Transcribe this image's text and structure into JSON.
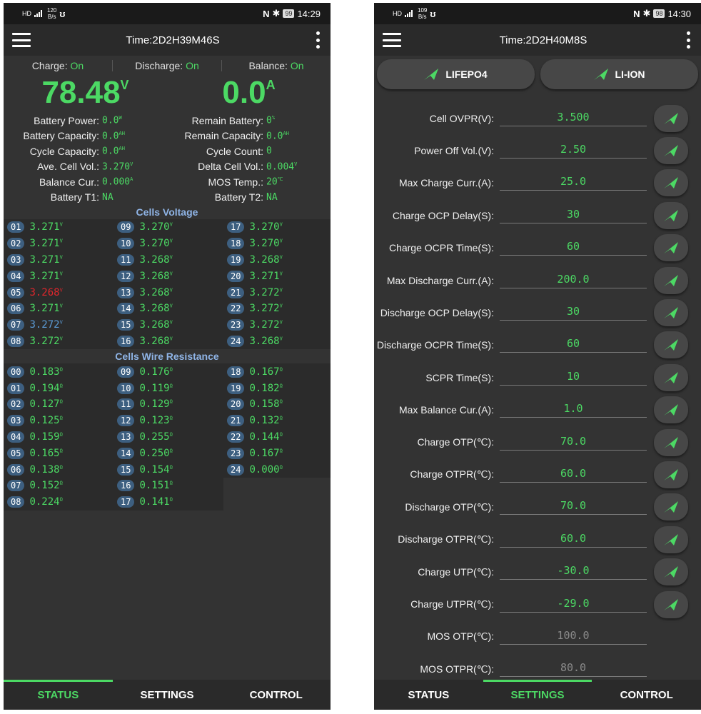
{
  "left": {
    "status_bar": {
      "net": "HD",
      "speed": "120",
      "speed_unit": "B/s",
      "battery": "99",
      "time": "14:29"
    },
    "app_bar": {
      "title": "Time:2D2H39M46S"
    },
    "switches": [
      {
        "label": "Charge:",
        "value": "On"
      },
      {
        "label": "Discharge:",
        "value": "On"
      },
      {
        "label": "Balance:",
        "value": "On"
      }
    ],
    "voltage": {
      "value": "78.48",
      "unit": "V"
    },
    "current": {
      "value": "0.0",
      "unit": "A"
    },
    "info_left": [
      {
        "label": "Battery Power:",
        "value": "0.0",
        "unit": "W"
      },
      {
        "label": "Battery Capacity:",
        "value": "0.0",
        "unit": "AH"
      },
      {
        "label": "Cycle Capacity:",
        "value": "0.0",
        "unit": "AH"
      },
      {
        "label": "Ave. Cell Vol.:",
        "value": "3.270",
        "unit": "V"
      },
      {
        "label": "Balance Cur.:",
        "value": "0.000",
        "unit": "A"
      },
      {
        "label": "Battery T1:",
        "value": "NA",
        "unit": ""
      }
    ],
    "info_right": [
      {
        "label": "Remain Battery:",
        "value": "0",
        "unit": "%"
      },
      {
        "label": "Remain Capacity:",
        "value": "0.0",
        "unit": "AH"
      },
      {
        "label": "Cycle Count:",
        "value": "0",
        "unit": ""
      },
      {
        "label": "Delta Cell Vol.:",
        "value": "0.004",
        "unit": "V"
      },
      {
        "label": "MOS Temp.:",
        "value": "20",
        "unit": "℃"
      },
      {
        "label": "Battery T2:",
        "value": "NA",
        "unit": ""
      }
    ],
    "cells_voltage_title": "Cells Voltage",
    "cells_voltage": [
      {
        "no": "01",
        "v": "3.271",
        "u": "V"
      },
      {
        "no": "09",
        "v": "3.270",
        "u": "V"
      },
      {
        "no": "17",
        "v": "3.270",
        "u": "V"
      },
      {
        "no": "02",
        "v": "3.271",
        "u": "V"
      },
      {
        "no": "10",
        "v": "3.270",
        "u": "V"
      },
      {
        "no": "18",
        "v": "3.270",
        "u": "V"
      },
      {
        "no": "03",
        "v": "3.271",
        "u": "V"
      },
      {
        "no": "11",
        "v": "3.268",
        "u": "V"
      },
      {
        "no": "19",
        "v": "3.268",
        "u": "V"
      },
      {
        "no": "04",
        "v": "3.271",
        "u": "V"
      },
      {
        "no": "12",
        "v": "3.268",
        "u": "V"
      },
      {
        "no": "20",
        "v": "3.271",
        "u": "V"
      },
      {
        "no": "05",
        "v": "3.268",
        "u": "V",
        "color": "#e0262c"
      },
      {
        "no": "13",
        "v": "3.268",
        "u": "V"
      },
      {
        "no": "21",
        "v": "3.272",
        "u": "V"
      },
      {
        "no": "06",
        "v": "3.271",
        "u": "V"
      },
      {
        "no": "14",
        "v": "3.268",
        "u": "V"
      },
      {
        "no": "22",
        "v": "3.272",
        "u": "V"
      },
      {
        "no": "07",
        "v": "3.272",
        "u": "V",
        "color": "#5b9bd5"
      },
      {
        "no": "15",
        "v": "3.268",
        "u": "V"
      },
      {
        "no": "23",
        "v": "3.272",
        "u": "V"
      },
      {
        "no": "08",
        "v": "3.272",
        "u": "V"
      },
      {
        "no": "16",
        "v": "3.268",
        "u": "V"
      },
      {
        "no": "24",
        "v": "3.268",
        "u": "V"
      }
    ],
    "cells_resistance_title": "Cells Wire Resistance",
    "cells_resistance": [
      {
        "no": "00",
        "v": "0.183",
        "u": "Ω"
      },
      {
        "no": "09",
        "v": "0.176",
        "u": "Ω"
      },
      {
        "no": "18",
        "v": "0.167",
        "u": "Ω"
      },
      {
        "no": "01",
        "v": "0.194",
        "u": "Ω"
      },
      {
        "no": "10",
        "v": "0.119",
        "u": "Ω"
      },
      {
        "no": "19",
        "v": "0.182",
        "u": "Ω"
      },
      {
        "no": "02",
        "v": "0.127",
        "u": "Ω"
      },
      {
        "no": "11",
        "v": "0.129",
        "u": "Ω"
      },
      {
        "no": "20",
        "v": "0.158",
        "u": "Ω"
      },
      {
        "no": "03",
        "v": "0.125",
        "u": "Ω"
      },
      {
        "no": "12",
        "v": "0.123",
        "u": "Ω"
      },
      {
        "no": "21",
        "v": "0.132",
        "u": "Ω"
      },
      {
        "no": "04",
        "v": "0.159",
        "u": "Ω"
      },
      {
        "no": "13",
        "v": "0.255",
        "u": "Ω"
      },
      {
        "no": "22",
        "v": "0.144",
        "u": "Ω"
      },
      {
        "no": "05",
        "v": "0.165",
        "u": "Ω"
      },
      {
        "no": "14",
        "v": "0.250",
        "u": "Ω"
      },
      {
        "no": "23",
        "v": "0.167",
        "u": "Ω"
      },
      {
        "no": "06",
        "v": "0.138",
        "u": "Ω"
      },
      {
        "no": "15",
        "v": "0.154",
        "u": "Ω"
      },
      {
        "no": "24",
        "v": "0.000",
        "u": "Ω"
      },
      {
        "no": "07",
        "v": "0.152",
        "u": "Ω"
      },
      {
        "no": "16",
        "v": "0.151",
        "u": "Ω"
      },
      null,
      {
        "no": "08",
        "v": "0.224",
        "u": "Ω"
      },
      {
        "no": "17",
        "v": "0.141",
        "u": "Ω"
      },
      null
    ],
    "nav": {
      "active": 0,
      "tabs": [
        "STATUS",
        "SETTINGS",
        "CONTROL"
      ]
    }
  },
  "right": {
    "status_bar": {
      "net": "HD",
      "speed": "109",
      "speed_unit": "B/s",
      "battery": "98",
      "time": "14:30"
    },
    "app_bar": {
      "title": "Time:2D2H40M8S"
    },
    "type_buttons": [
      "LIFEPO4",
      "LI-ION"
    ],
    "settings": [
      {
        "label": "Cell OVPR(V):",
        "value": "3.500",
        "send": true
      },
      {
        "label": "Power Off Vol.(V):",
        "value": "2.50",
        "send": true
      },
      {
        "label": "Max Charge Curr.(A):",
        "value": "25.0",
        "send": true
      },
      {
        "label": "Charge OCP Delay(S):",
        "value": "30",
        "send": true
      },
      {
        "label": "Charge OCPR Time(S):",
        "value": "60",
        "send": true
      },
      {
        "label": "Max Discharge Curr.(A):",
        "value": "200.0",
        "send": true
      },
      {
        "label": "Discharge OCP Delay(S):",
        "value": "30",
        "send": true
      },
      {
        "label": "Discharge OCPR Time(S):",
        "value": "60",
        "send": true
      },
      {
        "label": "SCPR Time(S):",
        "value": "10",
        "send": true
      },
      {
        "label": "Max Balance Cur.(A):",
        "value": "1.0",
        "send": true
      },
      {
        "label": "Charge OTP(℃):",
        "value": "70.0",
        "send": true
      },
      {
        "label": "Charge OTPR(℃):",
        "value": "60.0",
        "send": true
      },
      {
        "label": "Discharge OTP(℃):",
        "value": "70.0",
        "send": true
      },
      {
        "label": "Discharge OTPR(℃):",
        "value": "60.0",
        "send": true
      },
      {
        "label": "Charge UTP(℃):",
        "value": "-30.0",
        "send": true
      },
      {
        "label": "Charge UTPR(℃):",
        "value": "-29.0",
        "send": true
      },
      {
        "label": "MOS OTP(℃):",
        "value": "100.0",
        "send": false
      },
      {
        "label": "MOS OTPR(℃):",
        "value": "80.0",
        "send": false
      }
    ],
    "nav": {
      "active": 1,
      "tabs": [
        "STATUS",
        "SETTINGS",
        "CONTROL"
      ]
    }
  },
  "colors": {
    "accent": "#4cd964",
    "background": "#333333",
    "bar": "#2a2a2a",
    "badge": "#3d5f80",
    "title_blue": "#8fb4e6"
  },
  "icons": [
    "menu-icon",
    "more-vert-icon",
    "send-icon",
    "nfc-icon",
    "bluetooth-icon",
    "signal-icon"
  ]
}
